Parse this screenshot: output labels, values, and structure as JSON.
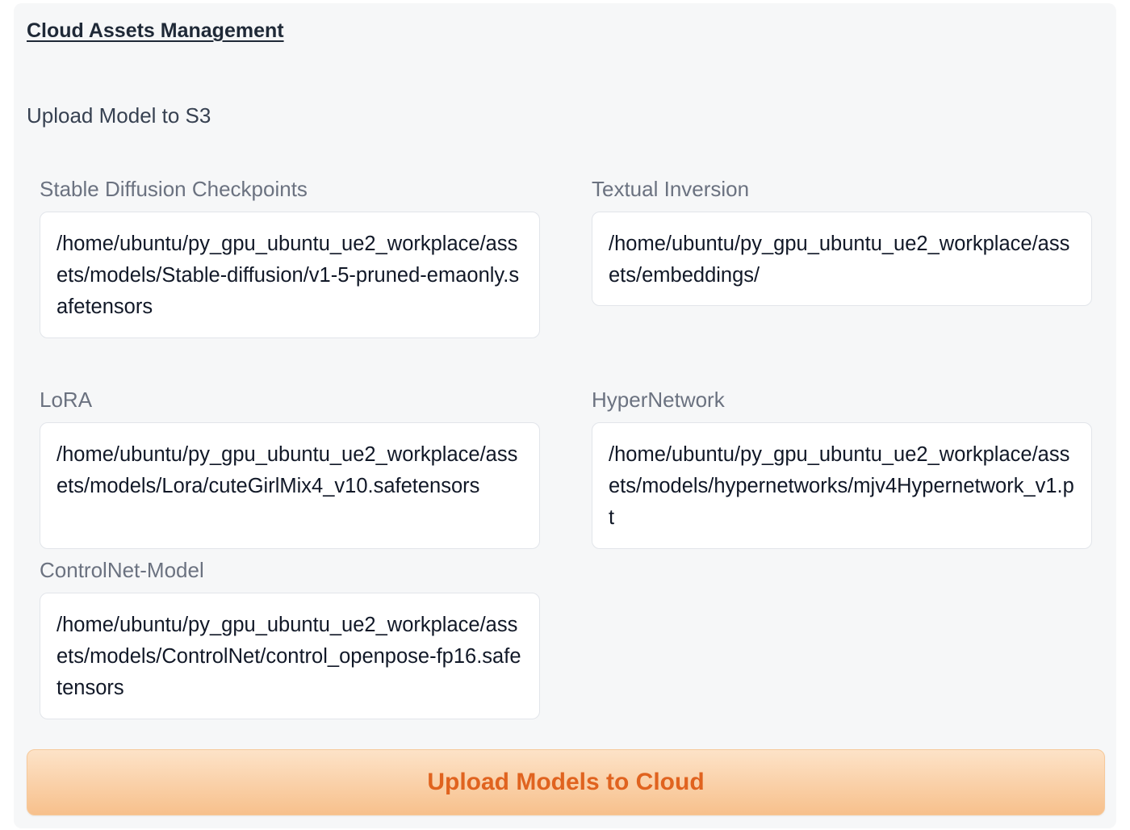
{
  "section": {
    "title": "Cloud Assets Management",
    "subtitle": "Upload Model to S3"
  },
  "fields": [
    {
      "label": "Stable Diffusion Checkpoints",
      "value": "/home/ubuntu/py_gpu_ubuntu_ue2_workplace/assets/models/Stable-diffusion/v1-5-pruned-emaonly.safetensors"
    },
    {
      "label": "Textual Inversion",
      "value": "/home/ubuntu/py_gpu_ubuntu_ue2_workplace/assets/embeddings/"
    },
    {
      "label": "LoRA",
      "value": "/home/ubuntu/py_gpu_ubuntu_ue2_workplace/assets/models/Lora/cuteGirlMix4_v10.safetensors"
    },
    {
      "label": "HyperNetwork",
      "value": "/home/ubuntu/py_gpu_ubuntu_ue2_workplace/assets/models/hypernetworks/mjv4Hypernetwork_v1.pt"
    },
    {
      "label": "ControlNet-Model",
      "value": "/home/ubuntu/py_gpu_ubuntu_ue2_workplace/assets/models/ControlNet/control_openpose-fp16.safetensors"
    }
  ],
  "actions": {
    "upload_label": "Upload Models to Cloud"
  },
  "colors": {
    "panel_bg": "#f6f7f8",
    "button_text": "#e0631f",
    "button_gradient_top": "#fde3c8",
    "button_gradient_bottom": "#f7c08c"
  }
}
